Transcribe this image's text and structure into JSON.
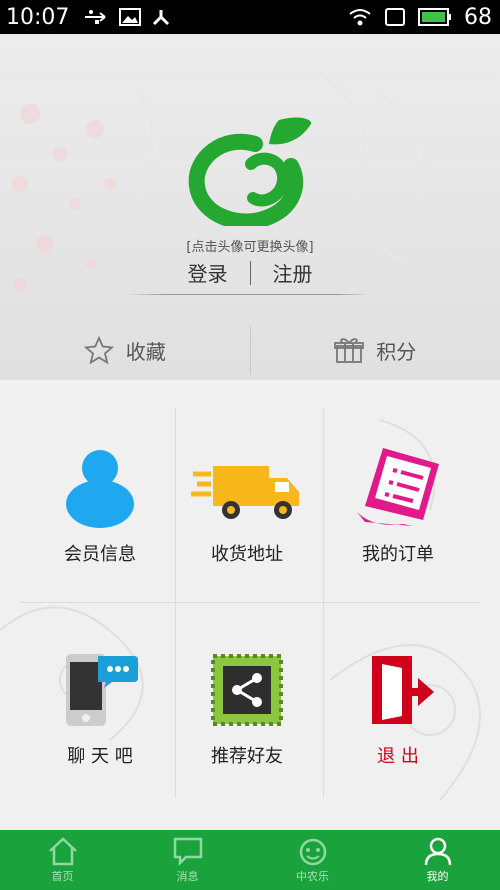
{
  "status_bar": {
    "time": "10:07",
    "battery": "68"
  },
  "profile": {
    "avatar_hint": "[点击头像可更换头像]",
    "login_label": "登录",
    "register_label": "注册",
    "favorites_label": "收藏",
    "points_label": "积分"
  },
  "grid": {
    "items": [
      {
        "label": "会员信息"
      },
      {
        "label": "收货地址"
      },
      {
        "label": "我的订单"
      },
      {
        "label": "聊 天 吧"
      },
      {
        "label": "推荐好友"
      },
      {
        "label": "退  出"
      }
    ]
  },
  "bottom_nav": {
    "items": [
      {
        "label": "首页"
      },
      {
        "label": "消息"
      },
      {
        "label": "中农乐"
      },
      {
        "label": "我的"
      }
    ]
  },
  "colors": {
    "brand_green": "#1aa23c",
    "accent_red": "#d0021b"
  }
}
